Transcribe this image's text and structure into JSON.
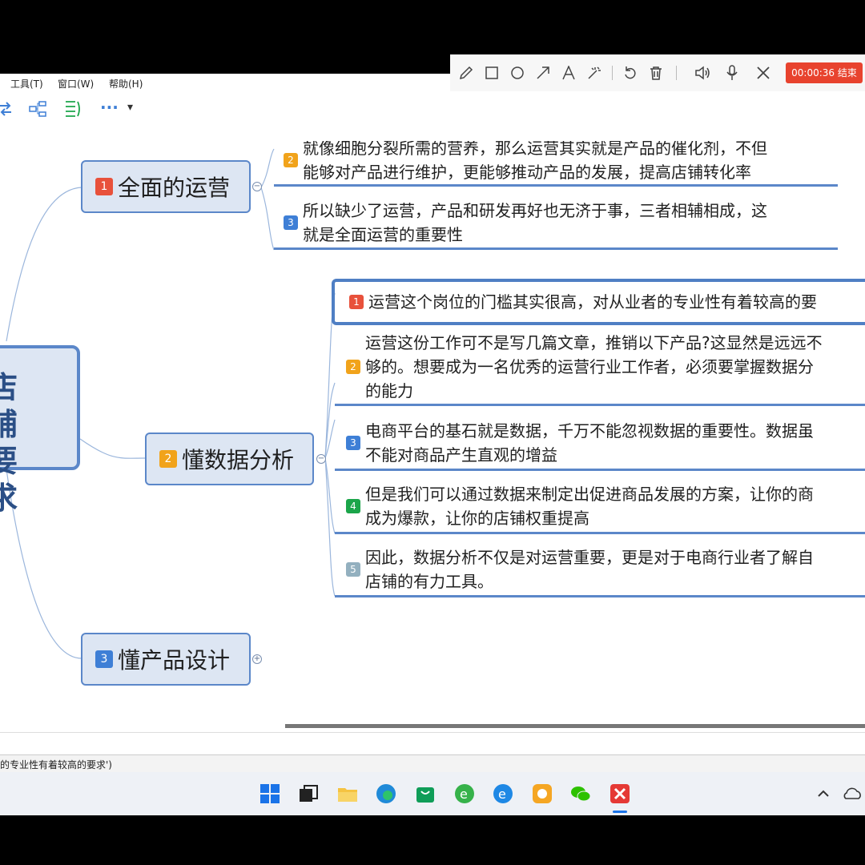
{
  "menu": {
    "tools": "工具(T)",
    "window": "窗口(W)",
    "help": "帮助(H)"
  },
  "toolbar": {
    "more": "···",
    "dropdown": "▾"
  },
  "recorder": {
    "timer": "00:00:36 结束"
  },
  "mindmap": {
    "central": {
      "line1": "店铺",
      "line2": "要求"
    },
    "topic1": {
      "num": "1",
      "label": "全面的运营",
      "toggle": "−"
    },
    "topic1_subs": [
      {
        "num": "2",
        "line1": "就像细胞分裂所需的营养，那么运营其实就是产品的催化剂，不但",
        "line2": "能够对产品进行维护，更能够推动产品的发展，提高店铺转化率"
      },
      {
        "num": "3",
        "line1": "所以缺少了运营，产品和研发再好也无济于事，三者相辅相成，这",
        "line2": "就是全面运营的重要性"
      }
    ],
    "topic2": {
      "num": "2",
      "label": "懂数据分析",
      "toggle": "−"
    },
    "topic2_subs": [
      {
        "num": "1",
        "line1": "运营这个岗位的门槛其实很高，对从业者的专业性有着较高的要"
      },
      {
        "num": "2",
        "line1": "运营这份工作可不是写几篇文章，推销以下产品?这显然是远远不",
        "line2": "够的。想要成为一名优秀的运营行业工作者，必须要掌握数据分",
        "line3": "的能力"
      },
      {
        "num": "3",
        "line1": "电商平台的基石就是数据，千万不能忽视数据的重要性。数据虽",
        "line2": "不能对商品产生直观的增益"
      },
      {
        "num": "4",
        "line1": "但是我们可以通过数据来制定出促进商品发展的方案，让你的商",
        "line2": "成为爆款，让你的店铺权重提高"
      },
      {
        "num": "5",
        "line1": "因此，数据分析不仅是对运营重要，更是对于电商行业者了解自",
        "line2": "店铺的有力工具。"
      }
    ],
    "topic3": {
      "num": "3",
      "label": "懂产品设计",
      "toggle": "+"
    }
  },
  "status": {
    "text": "的专业性有着较高的要求')"
  },
  "colors": {
    "accent": "#5b87c9",
    "topic_fill": "#dde6f3",
    "record": "#e8432e"
  },
  "taskbar_icons": [
    "windows-start-icon",
    "task-view-icon",
    "file-explorer-icon",
    "edge-icon",
    "store-icon",
    "browser-icon",
    "ie-icon",
    "wps-icon",
    "wechat-icon",
    "xmind-icon",
    "chevron-up-icon",
    "cloud-icon"
  ]
}
